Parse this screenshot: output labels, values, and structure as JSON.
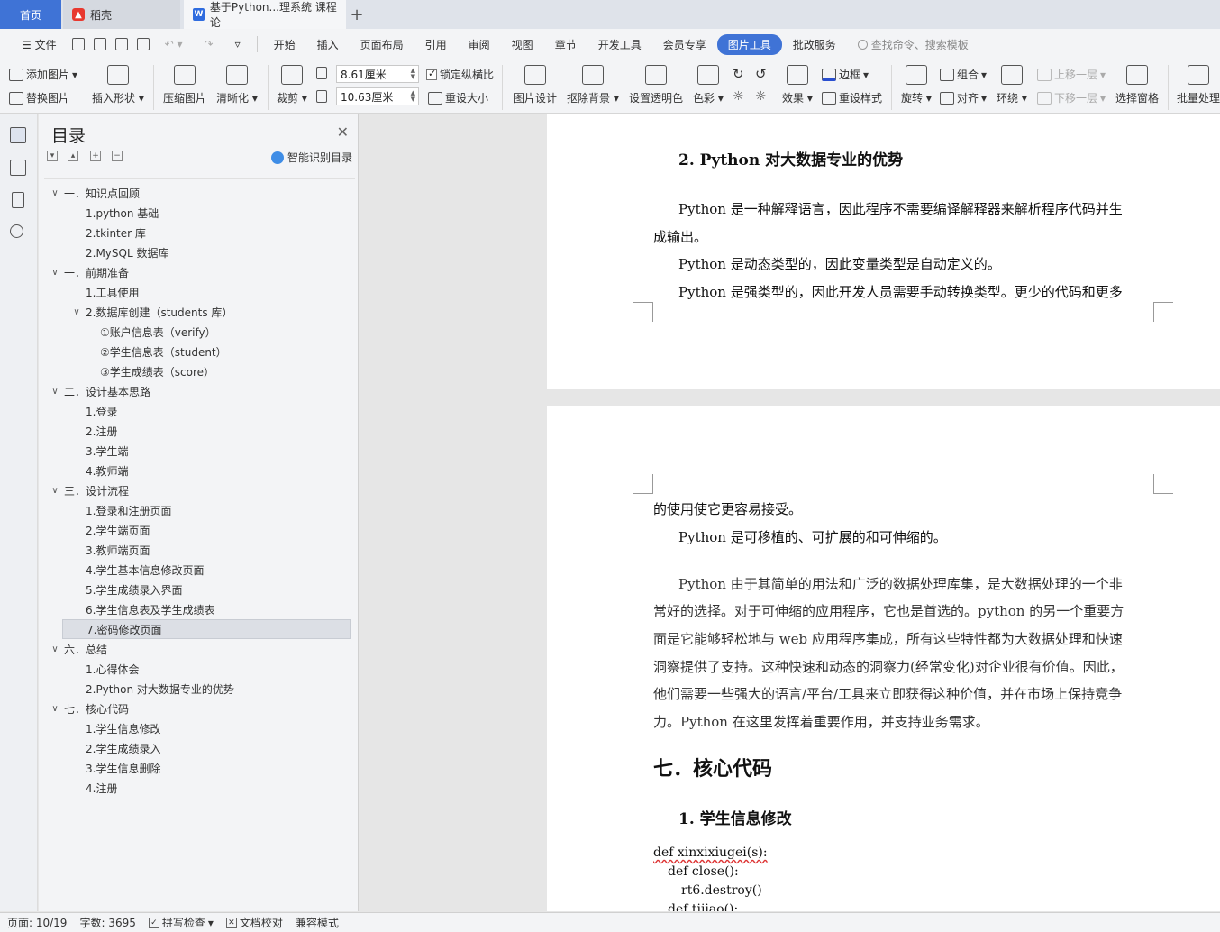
{
  "tabs": {
    "home": "首页",
    "daoke": "稻壳",
    "doc": "基于Python...理系统 课程论"
  },
  "menu": {
    "file": "文件",
    "items": [
      "开始",
      "插入",
      "页面布局",
      "引用",
      "审阅",
      "视图",
      "章节",
      "开发工具",
      "会员专享"
    ],
    "active": "图片工具",
    "after": "批改服务",
    "search": "查找命令、搜索模板"
  },
  "ribbon": {
    "add_image": "添加图片",
    "replace_image": "替换图片",
    "insert_shape": "插入形状",
    "compress": "压缩图片",
    "sharpen": "清晰化",
    "crop": "裁剪",
    "width": "8.61厘米",
    "height": "10.63厘米",
    "lock_ratio": "锁定纵横比",
    "reset_size": "重设大小",
    "image_design": "图片设计",
    "remove_bg": "抠除背景",
    "set_transparent": "设置透明色",
    "color": "色彩",
    "effects": "效果",
    "border": "边框",
    "reset_style": "重设样式",
    "rotate": "旋转",
    "group": "组合",
    "align": "对齐",
    "wrap": "环绕",
    "bring_forward": "上移一层",
    "send_backward": "下移一层",
    "select_pane": "选择窗格",
    "batch": "批量处理"
  },
  "toc": {
    "title": "目录",
    "ai_label": "智能识别目录",
    "items": [
      {
        "text": "一．知识点回顾",
        "level": 1,
        "caret": true
      },
      {
        "text": "1.python 基础",
        "level": 2
      },
      {
        "text": "2.tkinter 库",
        "level": 2
      },
      {
        "text": "2.MySQL 数据库",
        "level": 2
      },
      {
        "text": "一．前期准备",
        "level": 1,
        "caret": true
      },
      {
        "text": "1.工具使用",
        "level": 2
      },
      {
        "text": "2.数据库创建（students 库）",
        "level": 2,
        "caret": true
      },
      {
        "text": "①账户信息表（verify）",
        "level": 3
      },
      {
        "text": "②学生信息表（student）",
        "level": 3
      },
      {
        "text": "③学生成绩表（score）",
        "level": 3
      },
      {
        "text": "二．设计基本思路",
        "level": 1,
        "caret": true
      },
      {
        "text": "1.登录",
        "level": 2
      },
      {
        "text": "2.注册",
        "level": 2
      },
      {
        "text": "3.学生端",
        "level": 2
      },
      {
        "text": "4.教师端",
        "level": 2
      },
      {
        "text": "三．设计流程",
        "level": 1,
        "caret": true
      },
      {
        "text": "1.登录和注册页面",
        "level": 2
      },
      {
        "text": "2.学生端页面",
        "level": 2
      },
      {
        "text": "3.教师端页面",
        "level": 2
      },
      {
        "text": "4.学生基本信息修改页面",
        "level": 2
      },
      {
        "text": "5.学生成绩录入界面",
        "level": 2
      },
      {
        "text": "6.学生信息表及学生成绩表",
        "level": 2
      },
      {
        "text": "7.密码修改页面",
        "level": 2,
        "selected": true
      },
      {
        "text": "六．总结",
        "level": 1,
        "caret": true
      },
      {
        "text": "1.心得体会",
        "level": 2
      },
      {
        "text": "2.Python 对大数据专业的优势",
        "level": 2
      },
      {
        "text": "七．核心代码",
        "level": 1,
        "caret": true
      },
      {
        "text": "1.学生信息修改",
        "level": 2
      },
      {
        "text": "2.学生成绩录入",
        "level": 2
      },
      {
        "text": "3.学生信息删除",
        "level": 2
      },
      {
        "text": "4.注册",
        "level": 2
      }
    ]
  },
  "document": {
    "page1": {
      "heading": "2. Python 对大数据专业的优势",
      "p1a": "Python 是一种解释语言，因此程序不需要编译解释器来解析程序代码并生",
      "p1b": "成输出。",
      "p2": "Python 是动态类型的，因此变量类型是自动定义的。",
      "p3": "Python 是强类型的，因此开发人员需要手动转换类型。更少的代码和更多"
    },
    "page2": {
      "l1": "的使用使它更容易接受。",
      "l2": "Python 是可移植的、可扩展的和可伸缩的。",
      "p4": [
        "Python 由于其简单的用法和广泛的数据处理库集，是大数据处理的一个非",
        "常好的选择。对于可伸缩的应用程序，它也是首选的。python 的另一个重要方",
        "面是它能够轻松地与 web 应用程序集成，所有这些特性都为大数据处理和快速",
        "洞察提供了支持。这种快速和动态的洞察力(经常变化)对企业很有价值。因此，",
        "他们需要一些强大的语言/平台/工具来立即获得这种价值，并在市场上保持竞争",
        "力。Python 在这里发挥着重要作用，并支持业务需求。"
      ],
      "h1": "七．核心代码",
      "h2": "1. 学生信息修改",
      "code": [
        "def xinxixiugei(s):",
        "def close():",
        "rt6.destroy()",
        "def tijiao():"
      ]
    }
  },
  "status": {
    "page": "页面: 10/19",
    "words": "字数: 3695",
    "spell": "拼写检查",
    "proof": "文档校对",
    "compat": "兼容模式"
  },
  "colors": {
    "accent": "#3f73d6",
    "selected_row": "#dcdfe5"
  }
}
